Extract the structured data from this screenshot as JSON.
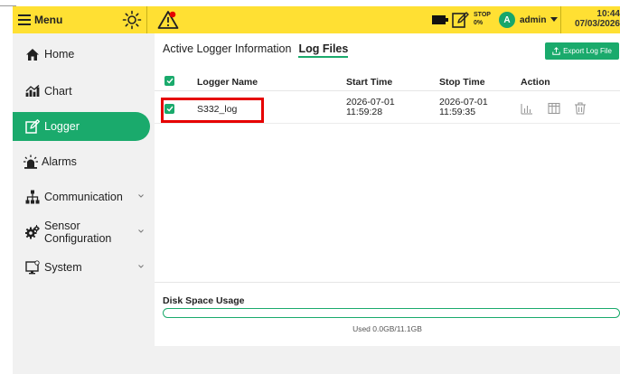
{
  "topbar": {
    "menu_label": "Menu",
    "icons": [
      "menu-icon",
      "brightness-icon",
      "warning-icon",
      "battery-icon",
      "edit-note-icon",
      "chevron-down-icon"
    ],
    "status_label": "STOP",
    "status_percent": "0%",
    "user_initial": "A",
    "user_name": "admin",
    "time": "10:44",
    "date": "07/03/2026",
    "accent_color": "#ffe033"
  },
  "sidebar": {
    "items": [
      {
        "label": "Home",
        "icon": "home-icon"
      },
      {
        "label": "Chart",
        "icon": "chart-icon"
      },
      {
        "label": "Logger",
        "icon": "logger-icon",
        "active": true
      },
      {
        "label": "Alarms",
        "icon": "alarm-icon"
      },
      {
        "label": "Communication",
        "icon": "network-icon",
        "expandable": true
      },
      {
        "label": "Sensor Configuration",
        "icon": "gear-icon",
        "expandable": true
      },
      {
        "label": "System",
        "icon": "monitor-icon",
        "expandable": true
      }
    ],
    "active_color": "#1aaa6c"
  },
  "main": {
    "tabs": [
      {
        "label": "Active Logger Information",
        "active": false
      },
      {
        "label": "Log Files",
        "active": true
      }
    ],
    "export_label": "Export Log File",
    "table": {
      "columns": [
        "Logger Name",
        "Start Time",
        "Stop Time",
        "Action"
      ],
      "rows": [
        {
          "checked": true,
          "name": "S332_log",
          "start_date": "2026-07-01",
          "start_time": "11:59:28",
          "stop_date": "2026-07-01",
          "stop_time": "11:59:35",
          "actions": [
            "chart-icon",
            "table-icon",
            "trash-icon"
          ]
        }
      ]
    },
    "disk": {
      "title": "Disk Space Usage",
      "used_text": "Used 0.0GB/11.1GB",
      "used_fraction": 0.0
    }
  }
}
